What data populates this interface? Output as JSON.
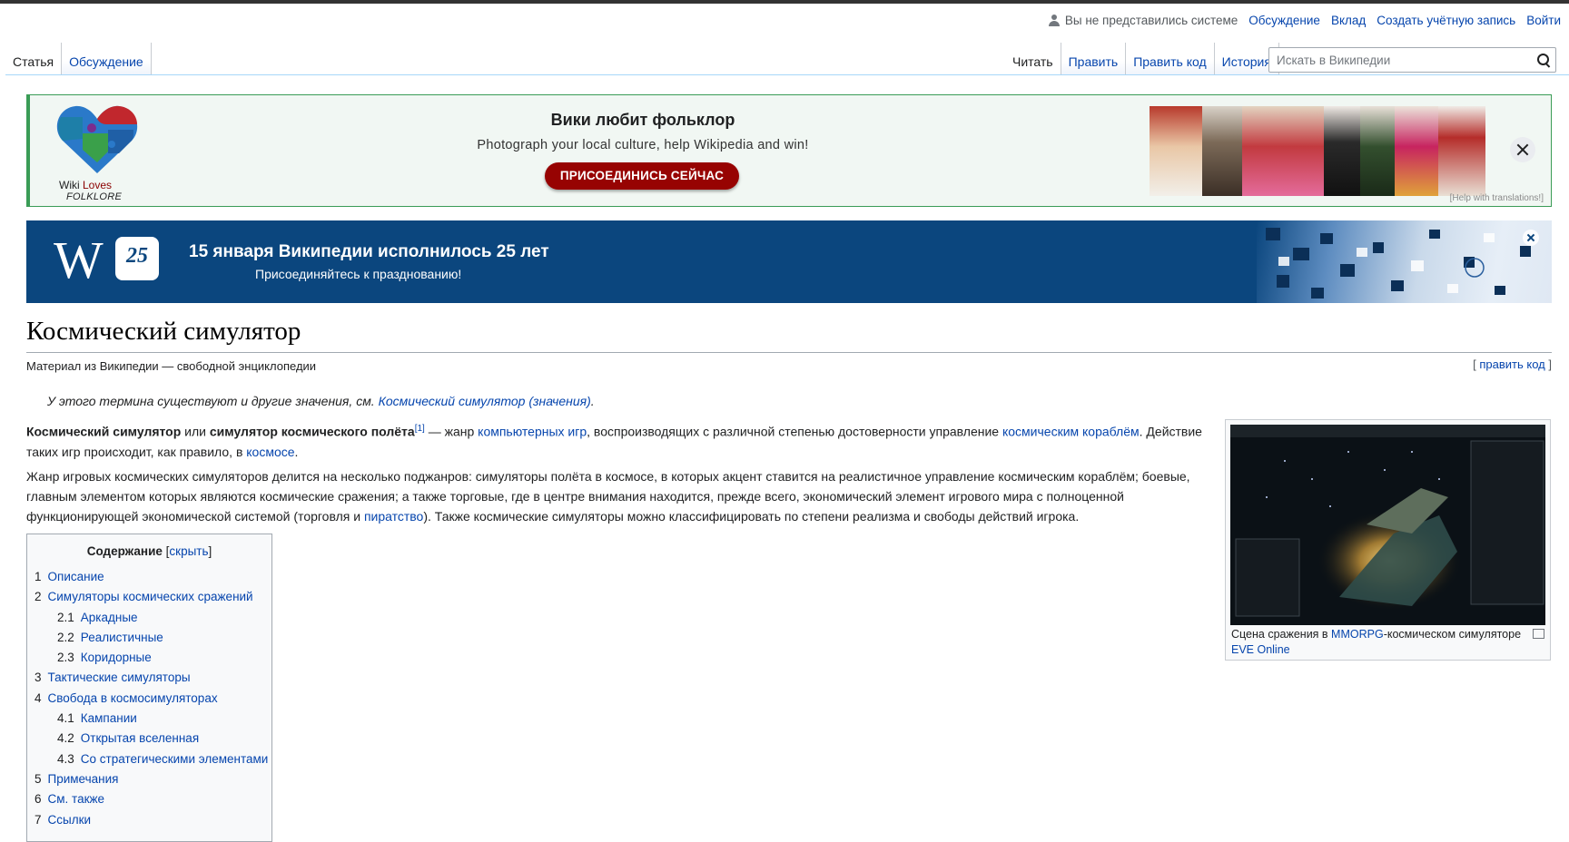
{
  "personal": {
    "anon_text": "Вы не представились системе",
    "links": [
      "Обсуждение",
      "Вклад",
      "Создать учётную запись",
      "Войти"
    ]
  },
  "tabs_left": [
    {
      "label": "Статья",
      "selected": true
    },
    {
      "label": "Обсуждение",
      "selected": false
    }
  ],
  "tabs_right": [
    {
      "label": "Читать",
      "selected": true
    },
    {
      "label": "Править",
      "selected": false
    },
    {
      "label": "Править код",
      "selected": false
    },
    {
      "label": "История",
      "selected": false
    }
  ],
  "search": {
    "placeholder": "Искать в Википедии"
  },
  "folklore_banner": {
    "logo_line1_a": "Wiki ",
    "logo_line1_b": "Loves",
    "logo_line2": "FOLKLORE",
    "title": "Вики любит фольклор",
    "subtitle": "Photograph your local culture, help Wikipedia and win!",
    "button": "ПРИСОЕДИНИСЬ СЕЙЧАС",
    "help": "[Help with translations!]"
  },
  "wp25_banner": {
    "logo_w": "W",
    "logo_num": "25",
    "title": "15 января Википедии исполнилось 25 лет",
    "subtitle": "Присоединяйтесь к празднованию!"
  },
  "article": {
    "title": "Космический симулятор",
    "tagline": "Материал из Википедии — свободной энциклопедии",
    "edit_code": {
      "open": "[ ",
      "label": "править код",
      "close": " ]"
    },
    "hatnote": {
      "text": "У этого термина существуют и другие значения, см. ",
      "link": "Космический симулятор (значения)",
      "end": "."
    },
    "p1": {
      "b1": "Космический симулятор",
      "t1": " или ",
      "b2": "симулятор космического полёта",
      "ref": "[1]",
      "t2": " — жанр ",
      "link1": "компьютерных игр",
      "t3": ", воспроизводящих с различной степенью достоверности управление ",
      "link2": "космическим кораблём",
      "t4": ". Действие таких игр происходит, как правило, в ",
      "link3": "космосе",
      "t5": "."
    },
    "p2": {
      "t1": "Жанр игровых космических симуляторов делится на несколько поджанров: симуляторы полёта в космосе, в которых акцент ставится на реалистичное управление космическим кораблём; боевые, главным элементом которых являются космические сражения; а также торговые, где в центре внимания находится, прежде всего, экономический элемент игрового мира с полноценной функционирующей экономической системой (торговля и ",
      "link": "пиратство",
      "t2": "). Также космические симуляторы можно классифицировать по степени реализма и свободы действий игрока."
    }
  },
  "thumb": {
    "caption_a": "Сцена сражения в ",
    "caption_link1": "MMORPG",
    "caption_b": "-космическом симуляторе ",
    "caption_link2": "EVE Online"
  },
  "toc": {
    "title": "Содержание",
    "toggle_open": " [",
    "toggle": "скрыть",
    "toggle_close": "]",
    "items": [
      {
        "num": "1",
        "label": "Описание",
        "level": 1
      },
      {
        "num": "2",
        "label": "Симуляторы космических сражений",
        "level": 1
      },
      {
        "num": "2.1",
        "label": "Аркадные",
        "level": 2
      },
      {
        "num": "2.2",
        "label": "Реалистичные",
        "level": 2
      },
      {
        "num": "2.3",
        "label": "Коридорные",
        "level": 2
      },
      {
        "num": "3",
        "label": "Тактические симуляторы",
        "level": 1
      },
      {
        "num": "4",
        "label": "Свобода в космосимуляторах",
        "level": 1
      },
      {
        "num": "4.1",
        "label": "Кампании",
        "level": 2
      },
      {
        "num": "4.2",
        "label": "Открытая вселенная",
        "level": 2
      },
      {
        "num": "4.3",
        "label": "Со стратегическими элементами",
        "level": 2
      },
      {
        "num": "5",
        "label": "Примечания",
        "level": 1
      },
      {
        "num": "6",
        "label": "См. также",
        "level": 1
      },
      {
        "num": "7",
        "label": "Ссылки",
        "level": 1
      }
    ]
  },
  "colors": {
    "link": "#0645ad",
    "banner_green": "#3a9c56",
    "banner_blue": "#0b467e",
    "button_red": "#970302"
  }
}
